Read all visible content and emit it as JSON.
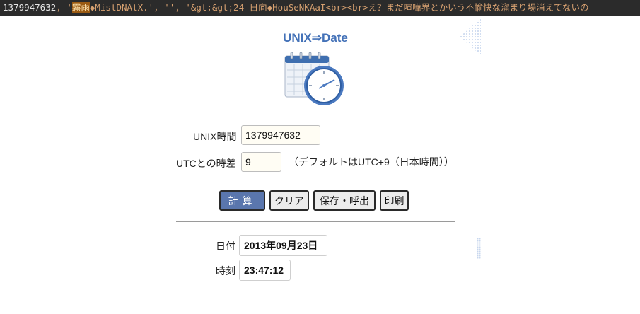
{
  "top_strip": {
    "number": "1379947632",
    "prefix": ", '",
    "highlight": "霧雨",
    "rest": "◆MistDNAtX.', '', '&gt;&gt;24 日向◆HouSeNKAaI<br><br>え？まだ喧嘩界とかいう不愉快な溜まり場消えてないの"
  },
  "app": {
    "title": "UNIX⇒Date",
    "logo_icon": "calendar-clock-icon"
  },
  "form": {
    "unix_label": "UNIX時間",
    "unix_value": "1379947632",
    "tz_label": "UTCとの時差",
    "tz_value": "9",
    "tz_note": "（デフォルトはUTC+9（日本時間））"
  },
  "buttons": {
    "calc": "計算",
    "clear": "クリア",
    "save": "保存・呼出",
    "print": "印刷"
  },
  "result": {
    "date_label": "日付",
    "date_value": "2013年09月23日",
    "time_label": "時刻",
    "time_value": "23:47:12"
  },
  "colors": {
    "title": "#4472b8",
    "primary_button": "#5a76ad",
    "highlight": "#9a5a12"
  }
}
